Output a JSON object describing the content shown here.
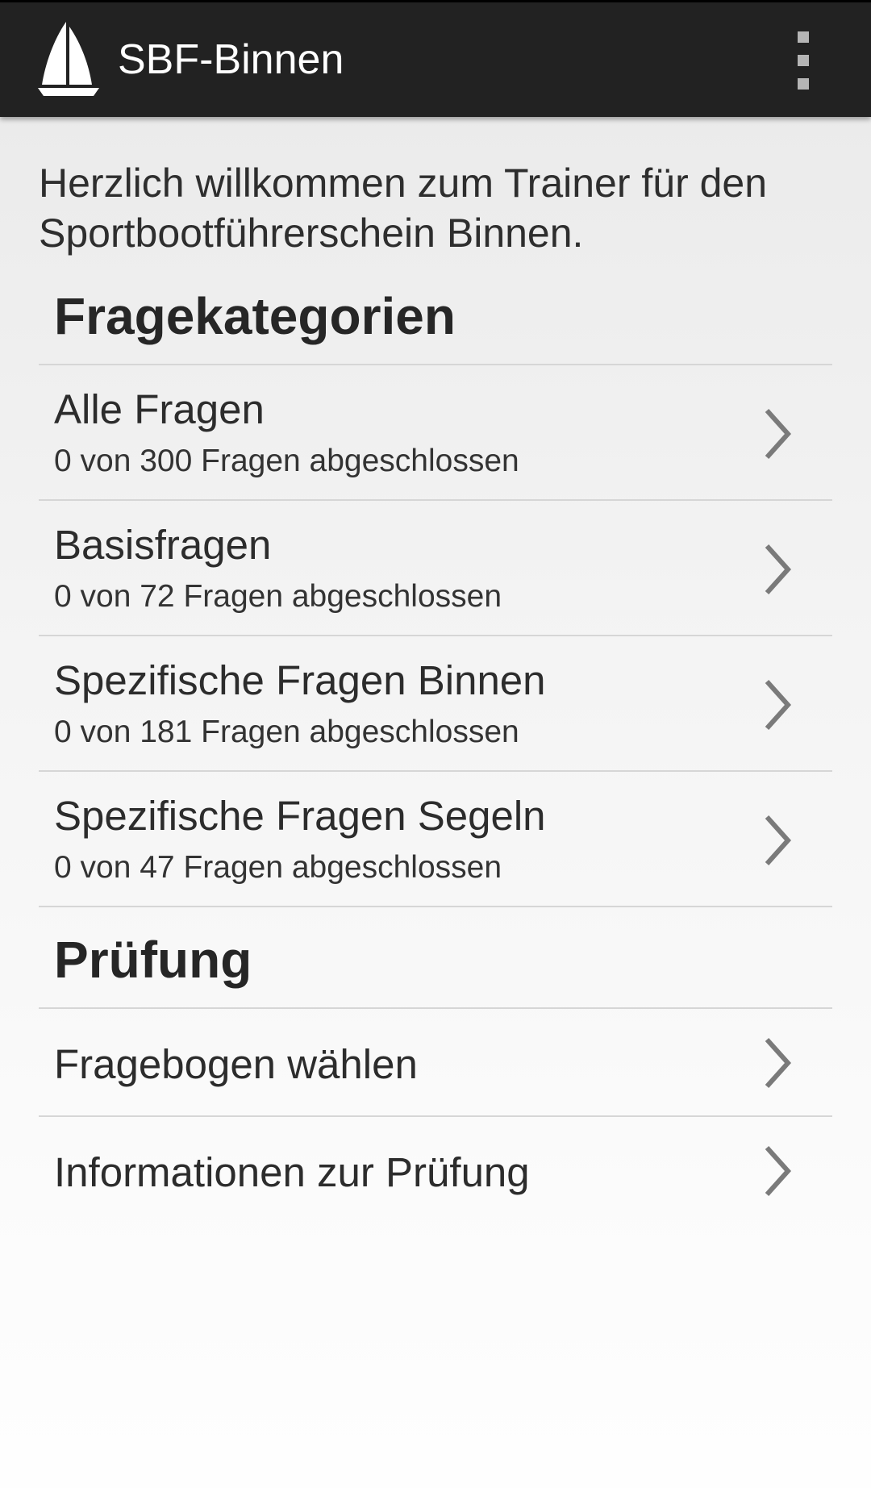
{
  "action_bar": {
    "title": "SBF-Binnen",
    "app_icon": "sailboat-icon",
    "menu_icon": "overflow-menu-icon",
    "background_color": "#222222"
  },
  "welcome_text": "Herzlich willkommen zum Trainer für den Sportbootführerschein Binnen.",
  "sections": {
    "categories": {
      "header": "Fragekategorien",
      "items": [
        {
          "title": "Alle Fragen",
          "subtitle": "0 von 300 Fragen abgeschlossen"
        },
        {
          "title": "Basisfragen",
          "subtitle": "0 von 72 Fragen abgeschlossen"
        },
        {
          "title": "Spezifische Fragen Binnen",
          "subtitle": "0 von 181 Fragen abgeschlossen"
        },
        {
          "title": "Spezifische Fragen Segeln",
          "subtitle": "0 von 47 Fragen abgeschlossen"
        }
      ]
    },
    "exam": {
      "header": "Prüfung",
      "items": [
        {
          "title": "Fragebogen wählen"
        },
        {
          "title": "Informationen zur Prüfung"
        }
      ]
    }
  },
  "chevron_icon": "chevron-right-icon"
}
